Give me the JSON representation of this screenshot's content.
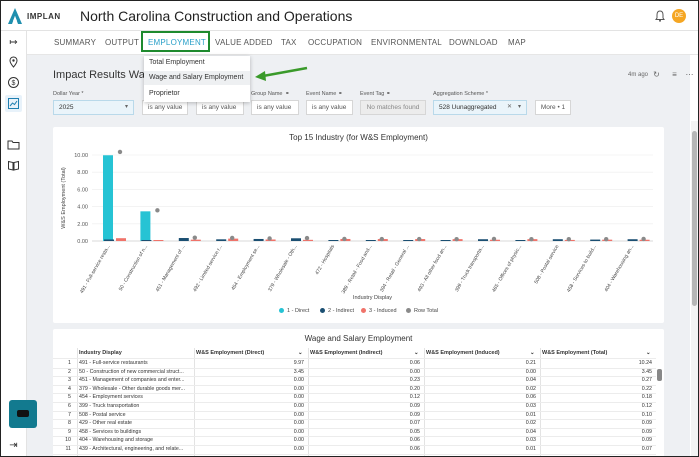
{
  "app": {
    "logo": "IMPLAN",
    "title": "North Carolina Construction and Operations",
    "avatar_initials": "DE"
  },
  "nav": {
    "tabs": [
      "SUMMARY",
      "OUTPUT",
      "EMPLOYMENT",
      "VALUE ADDED",
      "TAX",
      "OCCUPATION",
      "ENVIRONMENTAL",
      "DOWNLOAD",
      "MAP"
    ],
    "active": "EMPLOYMENT"
  },
  "dropdown": {
    "items": [
      "Total Employment",
      "Wage and Salary Employment",
      "Proprietor"
    ],
    "hovered": "Wage and Salary Employment"
  },
  "header": {
    "title": "Impact Results Wa",
    "timestamp": "4m ago"
  },
  "filters": {
    "dollar_year_label": "Dollar Year *",
    "dollar_year_value": "2025",
    "any1": "is any value",
    "any2": "is any value",
    "group_name_label": "Group Name",
    "any3": "is any value",
    "event_name_label": "Event Name",
    "any4": "is any value",
    "event_tag_label": "Event Tag",
    "event_tag_value": "No matches found",
    "agg_label": "Aggregation Scheme *",
    "agg_value": "528 Uunaggregated",
    "more": "More • 1"
  },
  "chart_data": {
    "type": "bar",
    "title": "Top 15 Industry (for W&S Employment)",
    "xlabel": "Industry Display",
    "ylabel": "W&S Employment (Total)",
    "ylim": [
      0,
      10
    ],
    "yticks": [
      "0.00",
      "2.00",
      "4.00",
      "6.00",
      "8.00",
      "10.00"
    ],
    "categories": [
      "491 - Full-service resta...",
      "50 - Construction of n...",
      "451 - Management of ...",
      "492 - Limited service r...",
      "454 - Employment se...",
      "379 - Wholesale - Oth...",
      "472 - Hospitals",
      "389 - Retail - Food and...",
      "394 - Retail - General ...",
      "493 - All other food an...",
      "399 - Truck transporta...",
      "465 - Offices of physic...",
      "508 - Postal service",
      "458 - Services to build...",
      "404 - Warehousing an..."
    ],
    "series": [
      {
        "name": "1 - Direct",
        "color": "#26c3d4",
        "values": [
          9.97,
          3.45,
          0,
          0,
          0,
          0,
          0,
          0,
          0,
          0,
          0,
          0,
          0,
          0,
          0
        ]
      },
      {
        "name": "2 - Indirect",
        "color": "#1b4f72",
        "values": [
          0.06,
          0.0,
          0.23,
          0.08,
          0.12,
          0.2,
          0,
          0,
          0,
          0,
          0.09,
          0,
          0.09,
          0.05,
          0.09
        ]
      },
      {
        "name": "3 - Induced",
        "color": "#f0736a",
        "values": [
          0.21,
          0.0,
          0.04,
          0.16,
          0.06,
          0.02,
          0.12,
          0.11,
          0.11,
          0.1,
          0.03,
          0.1,
          0.01,
          0.04,
          0.03
        ]
      },
      {
        "name": "Row Total",
        "color": "#8a8a8a",
        "values": [
          10.24,
          3.45,
          0.27,
          0.24,
          0.18,
          0.22,
          0.12,
          0.11,
          0.11,
          0.1,
          0.12,
          0.1,
          0.1,
          0.09,
          0.12
        ]
      }
    ]
  },
  "table": {
    "title": "Wage and Salary Employment",
    "columns": [
      "Industry Display",
      "W&S Employment (Direct)",
      "W&S Employment (Indirect)",
      "W&S Employment (Induced)",
      "W&S Employment (Total)"
    ],
    "rows": [
      [
        "1",
        "491 - Full-service restaurants",
        "9.97",
        "0.06",
        "0.21",
        "10.24"
      ],
      [
        "2",
        "50 - Construction of new commercial struct...",
        "3.45",
        "0.00",
        "0.00",
        "3.45"
      ],
      [
        "3",
        "451 - Management of companies and enter...",
        "0.00",
        "0.23",
        "0.04",
        "0.27"
      ],
      [
        "4",
        "379 - Wholesale - Other durable goods mer...",
        "0.00",
        "0.20",
        "0.02",
        "0.22"
      ],
      [
        "5",
        "454 - Employment services",
        "0.00",
        "0.12",
        "0.06",
        "0.18"
      ],
      [
        "6",
        "399 - Truck transportation",
        "0.00",
        "0.09",
        "0.03",
        "0.12"
      ],
      [
        "7",
        "508 - Postal service",
        "0.00",
        "0.09",
        "0.01",
        "0.10"
      ],
      [
        "8",
        "429 - Other real estate",
        "0.00",
        "0.07",
        "0.02",
        "0.09"
      ],
      [
        "9",
        "458 - Services to buildings",
        "0.00",
        "0.05",
        "0.04",
        "0.09"
      ],
      [
        "10",
        "404 - Warehousing and storage",
        "0.00",
        "0.06",
        "0.03",
        "0.09"
      ],
      [
        "11",
        "439 - Architectural, engineering, and relate...",
        "0.00",
        "0.06",
        "0.01",
        "0.07"
      ]
    ]
  },
  "colors": {
    "accent": "#2aa0c8",
    "highlight_box": "#1e8a2e",
    "arrow": "#3a9a2a"
  }
}
